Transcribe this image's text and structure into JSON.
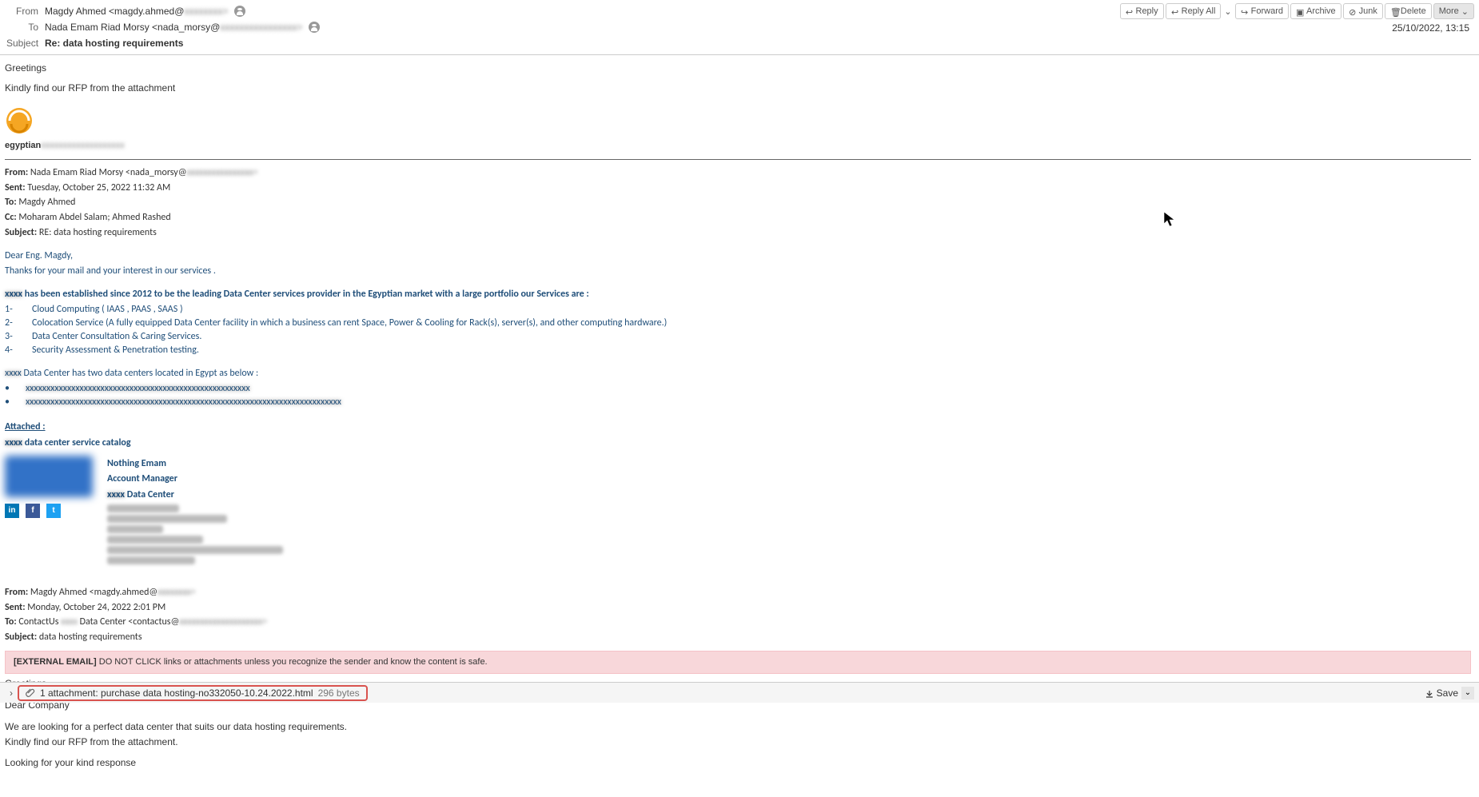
{
  "toolbar": {
    "reply": "Reply",
    "reply_all": "Reply All",
    "forward": "Forward",
    "archive": "Archive",
    "junk": "Junk",
    "delete": "Delete",
    "more": "More"
  },
  "header": {
    "from_label": "From",
    "from_value": "Magdy Ahmed <magdy.ahmed@",
    "from_blur": "xxxxxxxx>",
    "to_label": "To",
    "to_value": "Nada Emam Riad Morsy <nada_morsy@",
    "to_blur": "xxxxxxxxxxxxxxxx>",
    "subject_label": "Subject",
    "subject_value": "Re: data hosting requirements",
    "date": "25/10/2022, 13:15"
  },
  "body": {
    "greeting": "Greetings",
    "line1": "Kindly find our RFP from the attachment",
    "sig_prefix": "egyptian",
    "sig_blur": "xxxxxxxxxxxxxxxxxxx"
  },
  "quoted1": {
    "from_label": "From:",
    "from": " Nada Emam Riad Morsy <nada_morsy@",
    "from_blur": "xxxxxxxxxxxxxxxx>",
    "sent_label": "Sent:",
    "sent": " Tuesday, October 25, 2022 11:32 AM",
    "to_label": "To:",
    "to": " Magdy Ahmed",
    "cc_label": "Cc:",
    "cc": " Moharam Abdel Salam; Ahmed Rashed",
    "subject_label": "Subject:",
    "subject": " RE: data hosting requirements"
  },
  "reply_body": {
    "greet": "Dear Eng. Magdy,",
    "thanks": "Thanks for your mail and your interest in our services .",
    "blur_prefix": "xxxx",
    "intro": " has been established since 2012 to be the leading Data Center services provider in the Egyptian market with a large portfolio our Services are :",
    "items": [
      {
        "n": "1-",
        "t": "Cloud Computing ( IAAS , PAAS , SAAS )"
      },
      {
        "n": "2-",
        "t": "Colocation Service (A fully equipped Data Center facility in which a business can rent Space, Power & Cooling for Rack(s), server(s), and other computing hardware.)"
      },
      {
        "n": "3-",
        "t": "Data Center Consultation & Caring Services."
      },
      {
        "n": "4-",
        "t": "Security Assessment & Penetration testing."
      }
    ],
    "dc_prefix": "xxxx",
    "dc_line": " Data Center has two data centers located in Egypt as below :",
    "attached_label": "Attached :",
    "catalog_prefix": "xxxx",
    "catalog": " data center service catalog"
  },
  "sig": {
    "name": "Nothing Emam",
    "title": "Account Manager",
    "company_prefix": "xxxx",
    "company": " Data Center"
  },
  "quoted2": {
    "from_label": "From:",
    "from": " Magdy Ahmed <magdy.ahmed@",
    "from_blur": "xxxxxxxx>",
    "sent_label": "Sent:",
    "sent": " Monday, October 24, 2022 2:01 PM",
    "to_label": "To:",
    "to_a": " ContactUs ",
    "to_blur": "xxxx",
    "to_b": " Data Center <contactus@",
    "to_blur2": "xxxxxxxxxxxxxxxxxxxx>",
    "subject_label": "Subject:",
    "subject": " data hosting requirements"
  },
  "ext_warn": {
    "tag": "[EXTERNAL EMAIL]",
    "text": " DO NOT CLICK links or attachments unless you recognize the sender and know the content is safe."
  },
  "orig": {
    "greet": "Greetings",
    "dear": "Dear Company",
    "l1": "We are looking for a perfect data center that suits our data hosting requirements.",
    "l2": "Kindly find our RFP from the attachment.",
    "l3": "Looking for your kind response"
  },
  "attachment": {
    "label": "1 attachment: purchase data hosting-no332050-10.24.2022.html",
    "size": "296 bytes",
    "save": "Save"
  }
}
